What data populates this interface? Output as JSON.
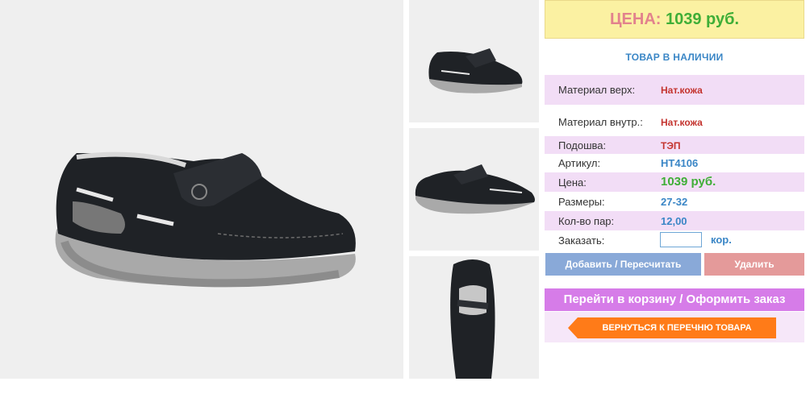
{
  "price": {
    "label": "ЦЕНА:",
    "value": "1039 руб."
  },
  "stock_status": "ТОВАР В НАЛИЧИИ",
  "specs": [
    {
      "label": "Материал верх:",
      "value": "Нат.кожа"
    },
    {
      "label": "Материал внутр.:",
      "value": "Нат.кожа"
    },
    {
      "label": "Подошва:",
      "value": "ТЭП"
    },
    {
      "label": "Артикул:",
      "value": "НТ4106"
    },
    {
      "label": "Цена:",
      "value": "1039 руб."
    },
    {
      "label": "Размеры:",
      "value": "27-32"
    },
    {
      "label": "Кол-во пар:",
      "value": "12,00"
    }
  ],
  "order": {
    "label": "Заказать:",
    "quantity_value": "",
    "unit": "кор."
  },
  "buttons": {
    "add": "Добавить / Пересчитать",
    "delete": "Удалить",
    "cart": "Перейти в корзину / Оформить заказ",
    "back": "ВЕРНУТЬСЯ К ПЕРЕЧНЮ ТОВАРА"
  },
  "colors": {
    "price_box": "#fbf1a2",
    "highlight_row": "#f2ddf6",
    "accent_blue": "#3a86c6",
    "price_green": "#3fae37",
    "cart_button": "#d67ce8",
    "back_button": "#ff7b18"
  },
  "images": {
    "main": "shoe-main-photo",
    "thumbnails": [
      "shoe-side-thumbnail",
      "shoe-angle-thumbnail",
      "shoe-top-thumbnail"
    ]
  }
}
